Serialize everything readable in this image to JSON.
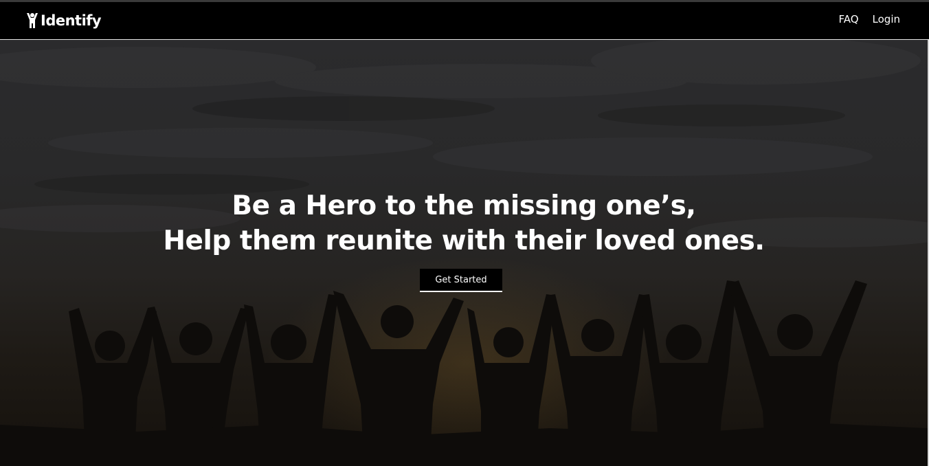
{
  "navbar": {
    "brand": "Identify",
    "links": [
      "FAQ",
      "Login"
    ]
  },
  "hero": {
    "headline_line1": "Be a Hero to the missing one’s,",
    "headline_line2": "Help them reunite with their loved ones.",
    "cta_label": "Get Started"
  },
  "colors": {
    "navbar_bg": "#000000",
    "text": "#ffffff",
    "button_bg": "#000000"
  },
  "icons": {
    "brand": "person-raised-arms-icon"
  }
}
